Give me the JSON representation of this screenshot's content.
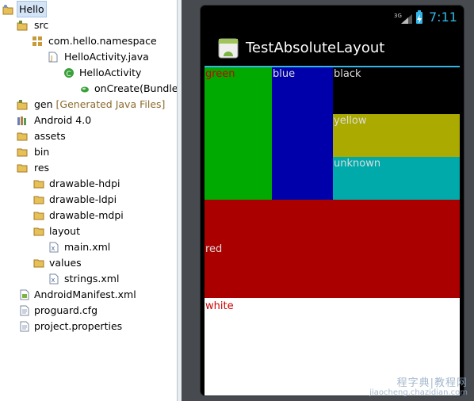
{
  "explorer": {
    "items": [
      {
        "label": "Hello",
        "icon": "project-icon",
        "level": 0,
        "selected": true
      },
      {
        "label": "src",
        "icon": "source-folder-icon",
        "level": 1
      },
      {
        "label": "com.hello.namespace",
        "icon": "package-icon",
        "level": 2
      },
      {
        "label": "HelloActivity.java",
        "icon": "java-file-icon",
        "level": 3
      },
      {
        "label": "HelloActivity",
        "icon": "class-icon",
        "level": 4
      },
      {
        "label": "onCreate(Bundle)",
        "icon": "method-icon",
        "level": 5
      },
      {
        "label": "gen",
        "suffix": "[Generated Java Files]",
        "icon": "source-folder-icon",
        "level": 1
      },
      {
        "label": "Android 4.0",
        "icon": "library-icon",
        "level": 1
      },
      {
        "label": "assets",
        "icon": "folder-icon",
        "level": 1
      },
      {
        "label": "bin",
        "icon": "folder-icon",
        "level": 1
      },
      {
        "label": "res",
        "icon": "folder-icon",
        "level": 1
      },
      {
        "label": "drawable-hdpi",
        "icon": "folder-icon",
        "level": 2
      },
      {
        "label": "drawable-ldpi",
        "icon": "folder-icon",
        "level": 2
      },
      {
        "label": "drawable-mdpi",
        "icon": "folder-icon",
        "level": 2
      },
      {
        "label": "layout",
        "icon": "folder-icon",
        "level": 2
      },
      {
        "label": "main.xml",
        "icon": "xml-file-icon",
        "level": 3
      },
      {
        "label": "values",
        "icon": "folder-icon",
        "level": 2
      },
      {
        "label": "strings.xml",
        "icon": "xml-file-icon",
        "level": 3
      },
      {
        "label": "AndroidManifest.xml",
        "icon": "android-manifest-icon",
        "level": 1
      },
      {
        "label": "proguard.cfg",
        "icon": "text-file-icon",
        "level": 1
      },
      {
        "label": "project.properties",
        "icon": "text-file-icon",
        "level": 1
      }
    ]
  },
  "device": {
    "status": {
      "network": "3G",
      "time": "7:11",
      "accent": "#33b5e5"
    },
    "app_title": "TestAbsoluteLayout",
    "views": [
      {
        "label": "green",
        "bg": "#00aa00",
        "text_color": "#cc0000"
      },
      {
        "label": "blue",
        "bg": "#0000aa",
        "text_color": "#dddddd"
      },
      {
        "label": "black",
        "bg": "#000000",
        "text_color": "#dddddd"
      },
      {
        "label": "yellow",
        "bg": "#aaaa00",
        "text_color": "#dddddd"
      },
      {
        "label": "unknown",
        "bg": "#00aaaa",
        "text_color": "#dddddd"
      },
      {
        "label": "red",
        "bg": "#aa0000",
        "text_color": "#dddddd"
      },
      {
        "label": "white",
        "bg": "#ffffff",
        "text_color": "#cc0000"
      }
    ]
  },
  "watermark": {
    "line1": "程字典|教程网",
    "line2": "jiaocheng.chazidian.com"
  }
}
